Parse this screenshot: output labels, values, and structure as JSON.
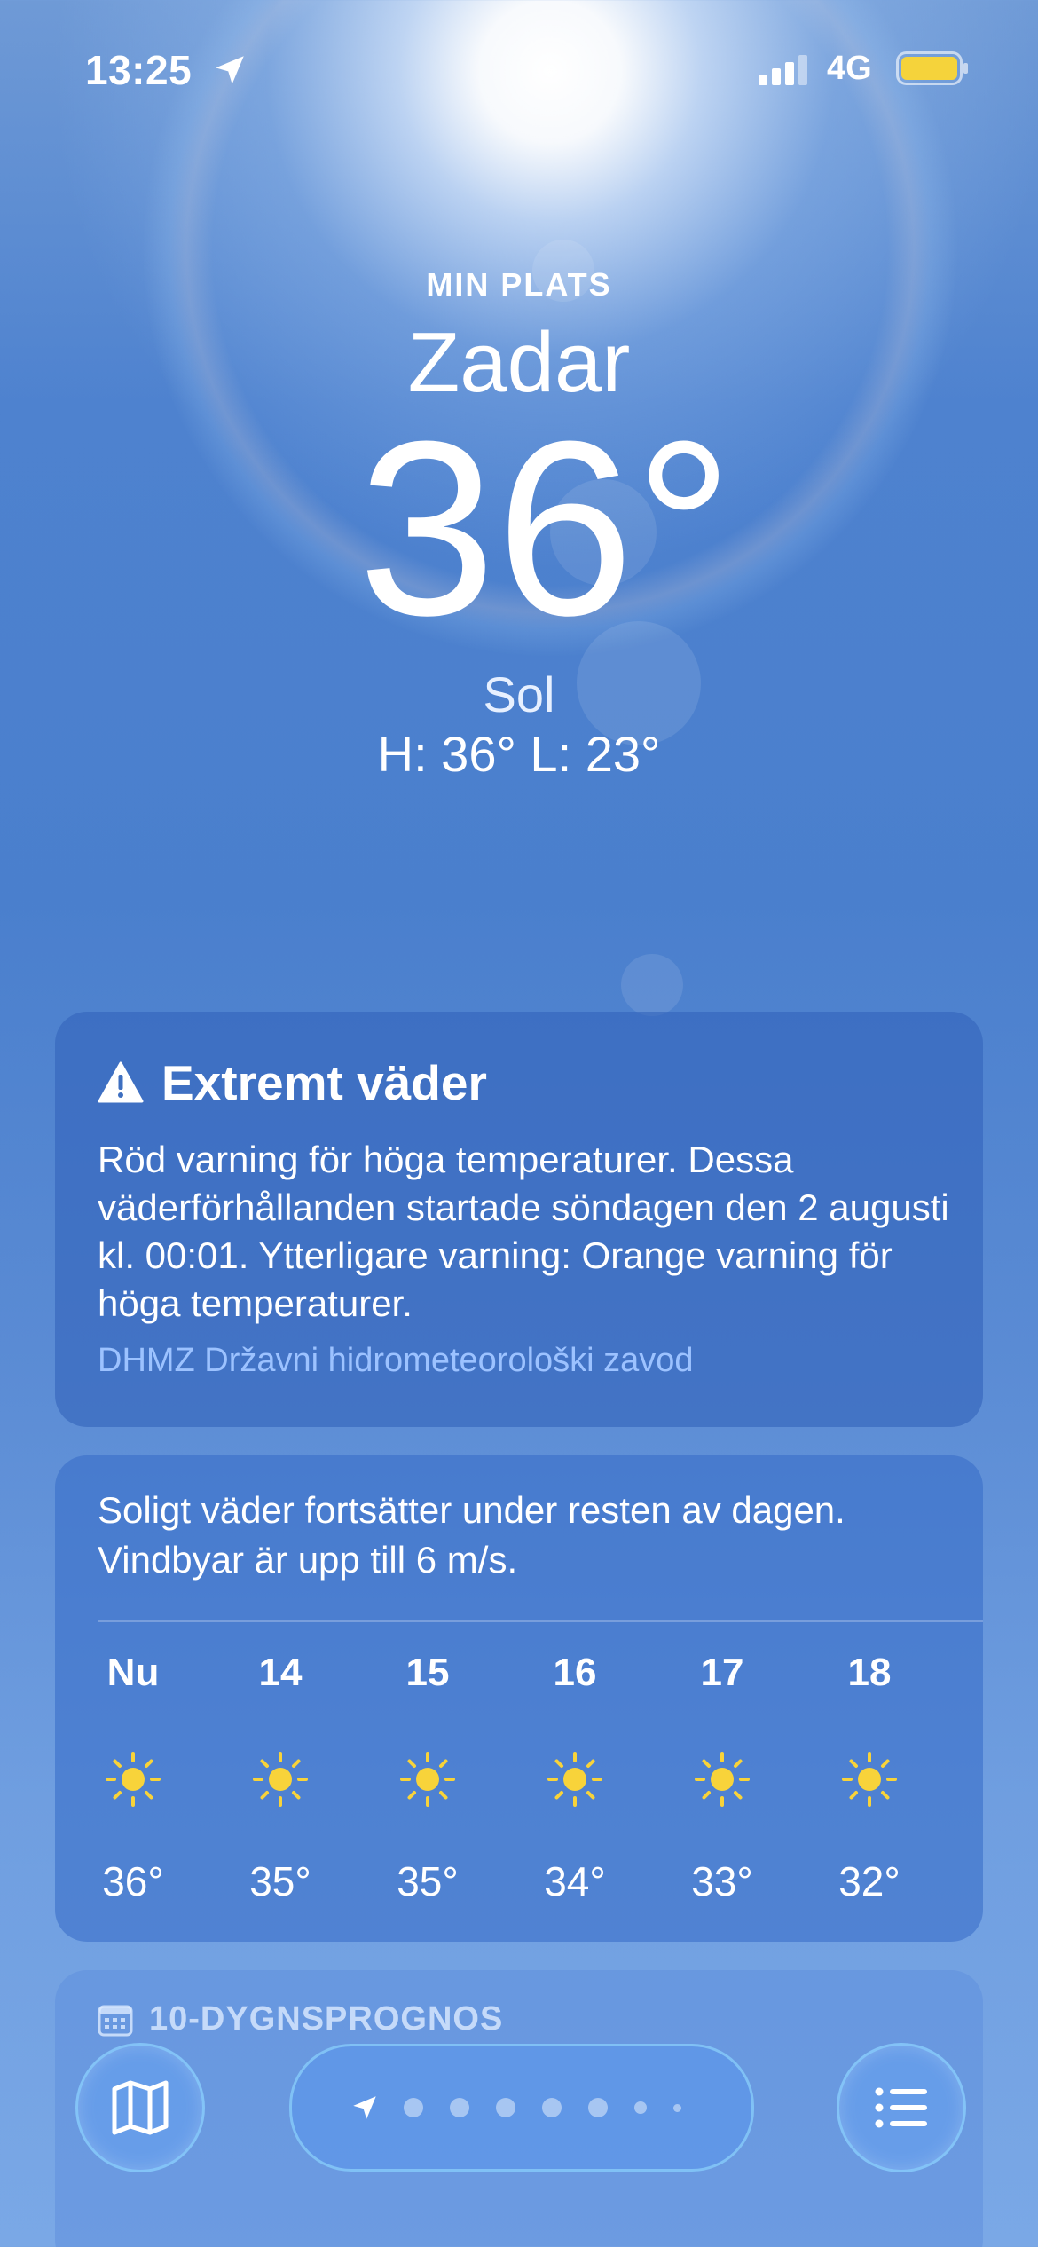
{
  "status_bar": {
    "time": "13:25",
    "network": "4G",
    "battery_color": "#f5d33b",
    "icons": [
      "location-arrow-icon",
      "signal-bars-icon",
      "battery-icon"
    ]
  },
  "header": {
    "location_label": "MIN PLATS",
    "city": "Zadar",
    "temperature": "36°",
    "condition": "Sol",
    "hi_lo": "H: 36°  L: 23°"
  },
  "alert": {
    "title": "Extremt väder",
    "text": "Röd varning för höga temperaturer. Dessa väderförhållanden startade söndagen den 2 augusti kl. 00:01. Ytterligare varning: Orange varning för höga temperaturer.",
    "source": "DHMZ Državni hidrometeorološki zavod",
    "icon": "warning-triangle-icon"
  },
  "hourly": {
    "summary": "Soligt väder fortsätter under resten av dagen. Vindbyar är upp till 6 m/s.",
    "hours": [
      {
        "label": "Nu",
        "temp": "36°",
        "icon": "sun-icon"
      },
      {
        "label": "14",
        "temp": "35°",
        "icon": "sun-icon"
      },
      {
        "label": "15",
        "temp": "35°",
        "icon": "sun-icon"
      },
      {
        "label": "16",
        "temp": "34°",
        "icon": "sun-icon"
      },
      {
        "label": "17",
        "temp": "33°",
        "icon": "sun-icon"
      },
      {
        "label": "18",
        "temp": "32°",
        "icon": "sun-icon"
      }
    ]
  },
  "forecast": {
    "header": "10-DYGNSPROGNOS",
    "icon": "calendar-icon"
  },
  "bottom_bar": {
    "map_icon": "map-icon",
    "list_icon": "list-icon",
    "page_count": 7,
    "current_page": "location"
  },
  "colors": {
    "sun": "#f8d33a",
    "alert_source": "#9cc2ff"
  }
}
